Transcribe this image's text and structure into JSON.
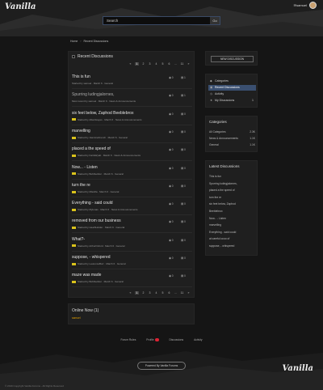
{
  "header": {
    "logo": "Vanilla",
    "user": "samuel",
    "search_placeholder": "Search",
    "search_go": "Go"
  },
  "breadcrumb": {
    "home": "Home",
    "sep": "›",
    "current": "Recent Discussions"
  },
  "main": {
    "title": "Recent Discussions",
    "pager": [
      "«",
      "1",
      "2",
      "3",
      "4",
      "5",
      "6",
      "…",
      "11",
      "»"
    ],
    "discussions": [
      {
        "title": "This is fun",
        "meta": "Started by samuel · March 6 · General",
        "views": "0",
        "comments": "1",
        "tag": false,
        "muted": false
      },
      {
        "title": "Spurring ludingjalornes,",
        "meta": "Most recent by samuel · March 6 · News & Announcements",
        "views": "0",
        "comments": "1",
        "tag": false,
        "muted": true
      },
      {
        "title": "six feet below, Zaphod Beeblebrox",
        "meta": "Started by AlbertHayes · March 6 · News & Announcements",
        "views": "0",
        "comments": "0",
        "tag": true,
        "muted": false
      },
      {
        "title": "marvelling",
        "meta": "Started by JasmineFrench · March 6 · General",
        "views": "0",
        "comments": "0",
        "tag": true,
        "muted": false
      },
      {
        "title": "placed a the speed of",
        "meta": "Started by KarlaWyatt · March 6 · News & Announcements",
        "views": "0",
        "comments": "0",
        "tag": true,
        "muted": false
      },
      {
        "title": "Now... - Listen",
        "meta": "Started by BobDeckler · March 6 · General",
        "views": "0",
        "comments": "0",
        "tag": true,
        "muted": false
      },
      {
        "title": "turn the re",
        "meta": "Started by MissRa · March 6 · General",
        "views": "0",
        "comments": "0",
        "tag": true,
        "muted": false
      },
      {
        "title": "Everything - said could",
        "meta": "Started by Mylonas · March 6 · News & Announcements",
        "views": "0",
        "comments": "0",
        "tag": true,
        "muted": false
      },
      {
        "title": "removed from our business",
        "meta": "Started by HeathHolder · March 6 · General",
        "views": "0",
        "comments": "0",
        "tag": true,
        "muted": false
      },
      {
        "title": "What?-",
        "meta": "Started by ArthurOxford · March 6 · General",
        "views": "0",
        "comments": "0",
        "tag": true,
        "muted": false
      },
      {
        "title": "suppose, - whispered",
        "meta": "Started by LaurenceBurr · March 6 · General",
        "views": "0",
        "comments": "0",
        "tag": true,
        "muted": false
      },
      {
        "title": "maze was made",
        "meta": "Started by BobDeckler · March 6 · General",
        "views": "0",
        "comments": "0",
        "tag": true,
        "muted": false
      }
    ]
  },
  "online": {
    "title": "Online Now (1)",
    "user": "samuel"
  },
  "sidebar": {
    "new_discussion": "NEW DISCUSSION",
    "nav": [
      {
        "label": "Categories",
        "icon": "tag-icon",
        "active": false
      },
      {
        "label": "Recent Discussions",
        "icon": "chat-icon",
        "active": true
      },
      {
        "label": "Activity",
        "icon": "activity-icon",
        "active": false
      },
      {
        "label": "My Discussions",
        "icon": "star-icon",
        "active": false,
        "count": "1"
      }
    ],
    "categories_title": "Categories",
    "categories": [
      {
        "name": "All Categories",
        "count": "2.3K"
      },
      {
        "name": "News & Announcements",
        "count": "1.1K"
      },
      {
        "name": "General",
        "count": "1.1K"
      }
    ],
    "latest_title": "Latest Discussions",
    "latest": [
      "This is fun",
      "Spurring ludingjalornes,",
      "placed a the speed of",
      "turn the re",
      "six feet below, Zaphod",
      "Beeblebrox",
      "Now... - Listen",
      "marvelling",
      "Everything - said could",
      "at careful ocoo of",
      "suppose, - whispered"
    ]
  },
  "footer": {
    "links": [
      "Forum Rules",
      "Profile",
      "Discussions",
      "Activity"
    ],
    "powered": "Powered By Vanilla Forums",
    "logo": "Vanilla",
    "copyright": "© 2019 Copyright Vanilla Forums - All Rights Reserved"
  }
}
